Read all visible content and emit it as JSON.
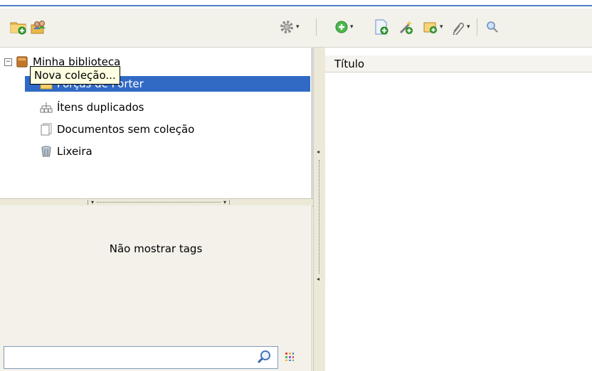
{
  "toolbar": {
    "buttons": [
      {
        "name": "new-collection",
        "icon": "folder-add-icon"
      },
      {
        "name": "new-group",
        "icon": "group-icon"
      },
      {
        "name": "actions",
        "icon": "gear-icon"
      },
      {
        "name": "new-item",
        "icon": "green-plus-icon"
      },
      {
        "name": "add-by-identifier",
        "icon": "document-add-icon"
      },
      {
        "name": "new-note",
        "icon": "wand-icon"
      },
      {
        "name": "add-attachment",
        "icon": "attachment-add-icon"
      },
      {
        "name": "attach",
        "icon": "paperclip-icon"
      },
      {
        "name": "search",
        "icon": "magnifier-icon"
      }
    ]
  },
  "tree": {
    "library": "Minha biblioteca",
    "items": [
      {
        "label": "Forças de Porter",
        "icon": "folder-icon",
        "selected": true
      },
      {
        "label": "Ítens duplicados",
        "icon": "duplicates-icon"
      },
      {
        "label": "Documentos sem coleção",
        "icon": "documents-icon"
      },
      {
        "label": "Lixeira",
        "icon": "trash-icon"
      }
    ]
  },
  "tooltip": "Nova coleção...",
  "tags": {
    "empty_label": "Não mostrar tags",
    "search_value": ""
  },
  "items_pane": {
    "column_header": "Título"
  },
  "colors": {
    "selection": "#316ac5",
    "tooltip_bg": "#ffffe1",
    "panel_bg": "#f3f1ea",
    "title_accent": "#4d7cc3"
  }
}
